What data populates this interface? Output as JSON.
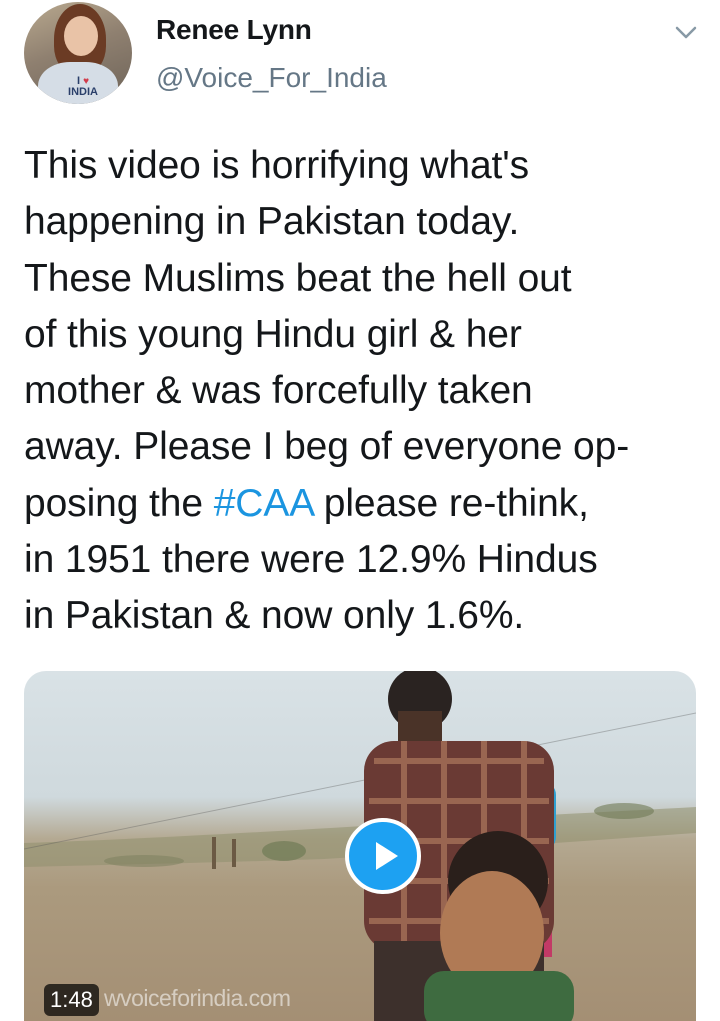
{
  "author": {
    "display_name": "Renee Lynn",
    "handle": "@Voice_For_India",
    "avatar_shirt_text": "I ♥ INDIA"
  },
  "tweet": {
    "lines": [
      {
        "before": "This video is horrifying what's",
        "hashtag": "",
        "after": ""
      },
      {
        "before": "happening in Pakistan today.",
        "hashtag": "",
        "after": ""
      },
      {
        "before": "These Muslims beat the hell out",
        "hashtag": "",
        "after": ""
      },
      {
        "before": "of this young Hindu girl & her",
        "hashtag": "",
        "after": ""
      },
      {
        "before": "mother & was forcefully taken",
        "hashtag": "",
        "after": ""
      },
      {
        "before": "away. Please I beg of everyone op-",
        "hashtag": "",
        "after": ""
      },
      {
        "before": "posing the ",
        "hashtag": "#CAA",
        "after": " please re-think,"
      },
      {
        "before": "in 1951 there were 12.9% Hindus",
        "hashtag": "",
        "after": ""
      },
      {
        "before": "in Pakistan & now only 1.6%.",
        "hashtag": "",
        "after": ""
      }
    ]
  },
  "media": {
    "duration": "1:48",
    "watermark": "wvoiceforindia.com"
  },
  "colors": {
    "text": "#14171a",
    "secondary": "#657786",
    "link": "#1b95e0",
    "play_button": "#1da1f2"
  },
  "icons": {
    "menu": "chevron-down-icon",
    "play": "play-icon"
  }
}
